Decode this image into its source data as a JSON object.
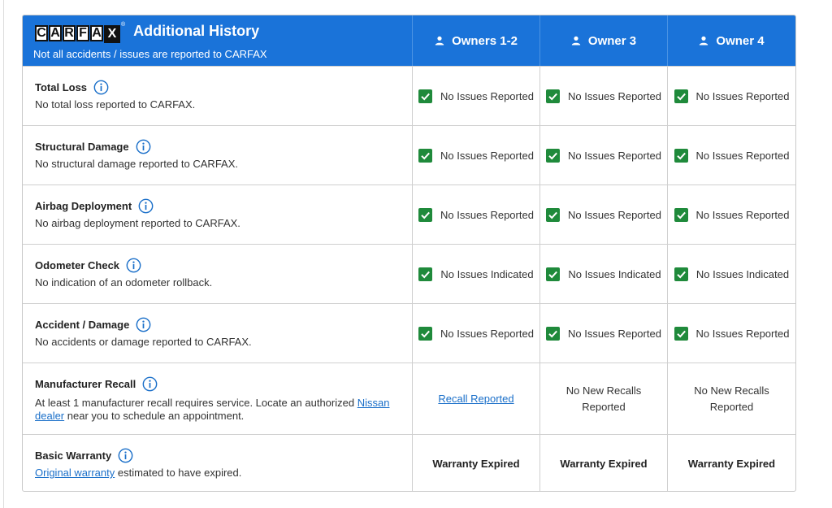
{
  "header": {
    "logo_letters": [
      "C",
      "A",
      "R",
      "F",
      "A"
    ],
    "logo_x": "X",
    "logo_tm": "®",
    "title": "Additional History",
    "subtitle": "Not all accidents / issues are reported to CARFAX",
    "owners": [
      "Owners 1-2",
      "Owner 3",
      "Owner 4"
    ]
  },
  "rows": [
    {
      "title": "Total Loss",
      "description": "No total loss reported to CARFAX.",
      "status": [
        "No Issues Reported",
        "No Issues Reported",
        "No Issues Reported"
      ]
    },
    {
      "title": "Structural Damage",
      "description": "No structural damage reported to CARFAX.",
      "status": [
        "No Issues Reported",
        "No Issues Reported",
        "No Issues Reported"
      ]
    },
    {
      "title": "Airbag Deployment",
      "description": "No airbag deployment reported to CARFAX.",
      "status": [
        "No Issues Reported",
        "No Issues Reported",
        "No Issues Reported"
      ]
    },
    {
      "title": "Odometer Check",
      "description": "No indication of an odometer rollback.",
      "status": [
        "No Issues Indicated",
        "No Issues Indicated",
        "No Issues Indicated"
      ]
    },
    {
      "title": "Accident / Damage",
      "description": "No accidents or damage reported to CARFAX.",
      "status": [
        "No Issues Reported",
        "No Issues Reported",
        "No Issues Reported"
      ]
    }
  ],
  "recall": {
    "title": "Manufacturer Recall",
    "description_before": "At least 1 manufacturer recall requires service. Locate an authorized ",
    "link_text": "Nissan dealer",
    "description_after": " near you to schedule an appointment.",
    "status": [
      "Recall Reported",
      "No New Recalls Reported",
      "No New Recalls Reported"
    ]
  },
  "warranty": {
    "title": "Basic Warranty",
    "link_text": "Original warranty",
    "description_after": " estimated to have expired.",
    "status": [
      "Warranty Expired",
      "Warranty Expired",
      "Warranty Expired"
    ]
  },
  "colors": {
    "header_bg": "#1a73d9",
    "check_green": "#1f8a3b",
    "link_blue": "#1a6fc9",
    "info_blue": "#1a6fc9"
  },
  "icons": {
    "owner": "person-icon",
    "info": "info-icon",
    "check": "check-box-icon"
  }
}
